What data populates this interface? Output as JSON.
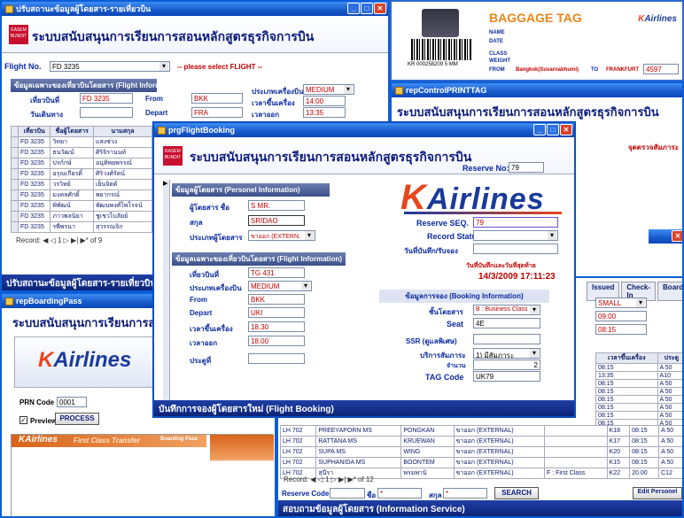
{
  "win_main": {
    "title": "ปรับสถานะข้อมูลผู้โดยสาร-รายเที่ยวบิน",
    "banner": "ระบบสนับสนุนการเรียนการสอนหลักสูตรธุรกิจการบิน",
    "flight_no_label": "Flight No.",
    "flight_no": "FD 3235",
    "select_flight": "-- please select FLIGHT --",
    "section": "ข้อมูลเฉพาะของเที่ยวบินโดยสาร (Flight Information)",
    "flight_label": "เที่ยวบินที่",
    "flight_value": "FD 3235",
    "from_label": "From",
    "from_value": "BKK",
    "date_label": "วันเดินทาง",
    "depart_label": "Depart",
    "depart_value": "FRA",
    "aircraft_label": "ประเภทเครื่องบิน",
    "aircraft_value": "MEDIUM",
    "boarding_label": "เวลาขึ้นเครื่อง",
    "boarding_value": "14:00",
    "exit_label": "เวลาออก",
    "exit_value": "13:35",
    "col_flight": "เที่ยวบิน",
    "col_name": "ชื่อผู้โดยสาร",
    "col_surname": "นามสกุล",
    "rows": [
      {
        "f": "FD 3235",
        "n": "วิทยา",
        "s": "แสงช่วง"
      },
      {
        "f": "FD 3235",
        "n": "ธนวัฒน์",
        "s": "ศิริจิรานนท์"
      },
      {
        "f": "FD 3235",
        "n": "ปรก์กษ์",
        "s": "อนุทิพยพรรณ์"
      },
      {
        "f": "FD 3235",
        "n": "อรุณเกียรติ์",
        "s": "ศิริวงศ์รัตน์"
      },
      {
        "f": "FD 3235",
        "n": "วรวิทย์",
        "s": "เย็นจิตต์"
      },
      {
        "f": "FD 3235",
        "n": "มงคลศักดิ์",
        "s": "พยากรณ์"
      },
      {
        "f": "FD 3235",
        "n": "พิพัฒน์",
        "s": "พัฒนพงศ์ไพโรจน์"
      },
      {
        "f": "FD 3235",
        "n": "ภาวพลนิยา",
        "s": "ชูเชวไบลัยย์"
      },
      {
        "f": "FD 3235",
        "n": "รพีพรนา",
        "s": "สุวรรณจิก"
      }
    ],
    "record_label": "Record:",
    "record_pos": "1",
    "record_total": "of 9",
    "status": "ปรับสถานะข้อมูลผู้โดยสาร-รายเที่ยวบิน"
  },
  "win_tag": {
    "title": "BAGGAGE TAG",
    "brand_k": "K",
    "brand": "Airlines",
    "name_label": "NAME",
    "date_label": "DATE",
    "class_label": "CLASS",
    "weight_label": "WEIGHT",
    "from_label": "FROM",
    "from_value": "Bangkok(Suvarnabhumi)",
    "to_label": "TO",
    "to_value": "FRANKFURT",
    "barcode_text": "KR 000258209 5 MM",
    "tag_no": "4597"
  },
  "win_control": {
    "title": "repControlPRINTTAG",
    "banner": "ระบบสนับสนุนการเรียนการสอนหลักสูตรธุรกิจการบิน",
    "right_label": "จุดตรวจสัมภาระ"
  },
  "win_board": {
    "title": "repBoardingPass",
    "banner": "ระบบสนับสนุนการเรียนการสอน",
    "brand_k": "K",
    "brand": "Airlines",
    "prn_label": "PRN Code",
    "prn_value": "0001",
    "preview_label": "Preview",
    "process": "PROCESS",
    "pass_first": "First Class Transfer",
    "pass_label": "Boarding Pass"
  },
  "win_info": {
    "tabs": [
      "Issued",
      "Check-In",
      "Boarding"
    ],
    "size_value": "SMALL",
    "t1": "09:00",
    "t2": "08:15",
    "col_time": "เวลาขึ้นเครื่อง",
    "col_gate": "ประตู",
    "rows": [
      {
        "time": "08:15",
        "gate": "A 50"
      },
      {
        "time": "13:35",
        "gate": "A10"
      },
      {
        "time": "08:15",
        "gate": "A 50"
      },
      {
        "time": "08:15",
        "gate": "A 50"
      },
      {
        "time": "08:15",
        "gate": "A 50"
      },
      {
        "time": "08:15",
        "gate": "A 50"
      },
      {
        "time": "08:15",
        "gate": "A 50"
      },
      {
        "time": "08:15",
        "gate": "A 50"
      }
    ],
    "pass_rows": [
      {
        "f": "LH 702",
        "n": "PREEYAPORN MS",
        "s": "PONGKAN",
        "t": "ขาออก (EXTERNAL)",
        "c": "",
        "seat": "K18",
        "time": "08:15",
        "gate": "A 50"
      },
      {
        "f": "LH 702",
        "n": "RATTANA MS",
        "s": "KRUEWAN",
        "t": "ขาออก (EXTERNAL)",
        "c": "",
        "seat": "K17",
        "time": "08:15",
        "gate": "A 50"
      },
      {
        "f": "LH 702",
        "n": "SUPA MS",
        "s": "WING",
        "t": "ขาออก (EXTERNAL)",
        "c": "",
        "seat": "K20",
        "time": "08:15",
        "gate": "A 50"
      },
      {
        "f": "LH 702",
        "n": "SUPHANIDA MS",
        "s": "BOONTEM",
        "t": "ขาออก (EXTERNAL)",
        "c": "",
        "seat": "K15",
        "time": "08:15",
        "gate": "A 50"
      },
      {
        "f": "LH 702",
        "n": "สุนีรา",
        "s": "พรมพานิ",
        "t": "ขาออก (EXTERNAL)",
        "c": "F : First Class",
        "seat": "K22",
        "time": "20.00",
        "gate": "C12"
      }
    ],
    "record_label": "Record:",
    "record_pos": "1",
    "record_total": "of 12",
    "reserve_label": "Reserve Code",
    "name_label": "ชื่อ",
    "name_value": "*",
    "surname_label": "สกุล",
    "surname_value": "*",
    "search": "SEARCH",
    "edit": "Edit Personel",
    "status": "สอบถามข้อมูลผู้โดยสาร (Information Service)"
  },
  "win_booking": {
    "title": "prgFlightBooking",
    "banner": "ระบบสนับสนุนการเรียนการสอนหลักสูตรธุรกิจการบิน",
    "reserve_no_label": "Reserve No:",
    "reserve_no": "79",
    "personal_section": "ข้อมูลผู้โดยสาร (Personel Information)",
    "pname_label": "ผู้โดยสาร ชื่อ",
    "pname_value": "S MR.",
    "psur_label": "สกุล",
    "psur_value": "SRIDAO",
    "ptype_label": "ประเภทผู้โดยสาร",
    "ptype_value": "ขาออก (EXTERN.",
    "flight_section": "ข้อมูลเฉพาะของเที่ยวบินโดยสาร (Flight Information)",
    "fno_label": "เที่ยวบินที่",
    "fno_value": "TG 431",
    "ftype_label": "ประเภทเครื่องบิน",
    "ftype_value": "MEDIUM",
    "from_label": "From",
    "from_value": "BKK",
    "depart_label": "Depart",
    "depart_value": "UKI",
    "board_label": "เวลาขึ้นเครื่อง",
    "board_value": "18.30",
    "out_label": "เวลาออก",
    "out_value": "18.00",
    "note_label": "ประตูที่",
    "brand_k": "K",
    "brand": "Airlines",
    "seq_label": "Reserve SEQ.",
    "seq_value": "79",
    "record_status_label": "Record Status",
    "date_rec_label": "วันที่บันทึก/รับจอง",
    "date_caption": "วันที่บันทึกและวันที่สุดท้าย",
    "datetime": "14/3/2009 17:11:23",
    "booking_section": "ข้อมูลการจอง (Booking Information)",
    "class_label": "ชั้นโดยสาร",
    "class_value": "B : Business Class",
    "seat_label": "Seat",
    "seat_value": "4E",
    "ssr_label": "SSR (ดูแลพิเศษ)",
    "service_label": "บริการสัมภาระ",
    "service_value": "1) มีสัมภาระ",
    "count_label": "จำนวน",
    "count_value": "2",
    "tag_label": "TAG Code",
    "tag_value": "UK79",
    "status": "บันทึกการจองผู้โดยสารใหม่ (Flight Booking)"
  },
  "colors": {
    "brand_blue": "#1a3a9a",
    "brand_orange": "#e8461c",
    "title_bar": "#1659c9",
    "value_red": "#c00000"
  }
}
